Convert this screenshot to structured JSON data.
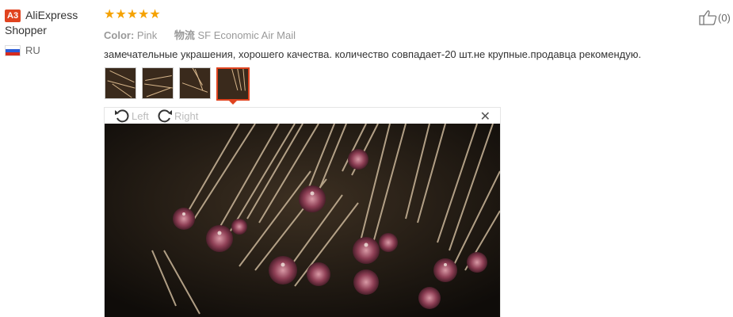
{
  "reviewer": {
    "badge": "A3",
    "name": "AliExpress Shopper",
    "country": "RU"
  },
  "review": {
    "rating": 5,
    "stars_text": "★★★★★",
    "color_label": "Color:",
    "color_value": "Pink",
    "shipping_label": "物流",
    "shipping_value": "SF Economic Air Mail",
    "text": "замечательные украшения, хорошего качества. количество совпадает-20 шт.не крупные.продавца рекомендую.",
    "photos_count": 4,
    "selected_photo": 4
  },
  "viewer": {
    "rotate_left": "Left",
    "rotate_right": "Right",
    "close": "✕"
  },
  "helpful": {
    "count": "(0)"
  },
  "colors": {
    "accent": "#e0431f",
    "star": "#f5a200"
  }
}
